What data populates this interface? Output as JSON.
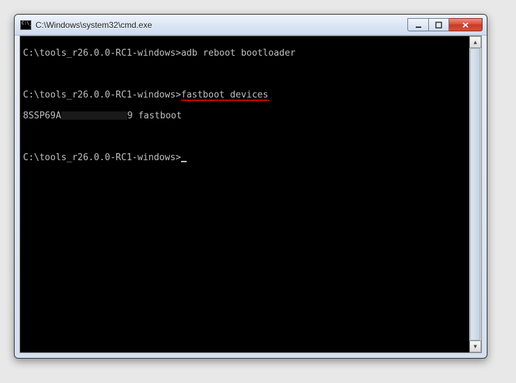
{
  "window": {
    "title": "C:\\Windows\\system32\\cmd.exe"
  },
  "console": {
    "prompt": "C:\\tools_r26.0.0-RC1-windows>",
    "line1_cmd": "adb reboot bootloader",
    "line2_cmd": "fastboot devices",
    "device_line_prefix": "8SSP69A",
    "device_line_suffix": "9 fastboot",
    "empty": ""
  }
}
